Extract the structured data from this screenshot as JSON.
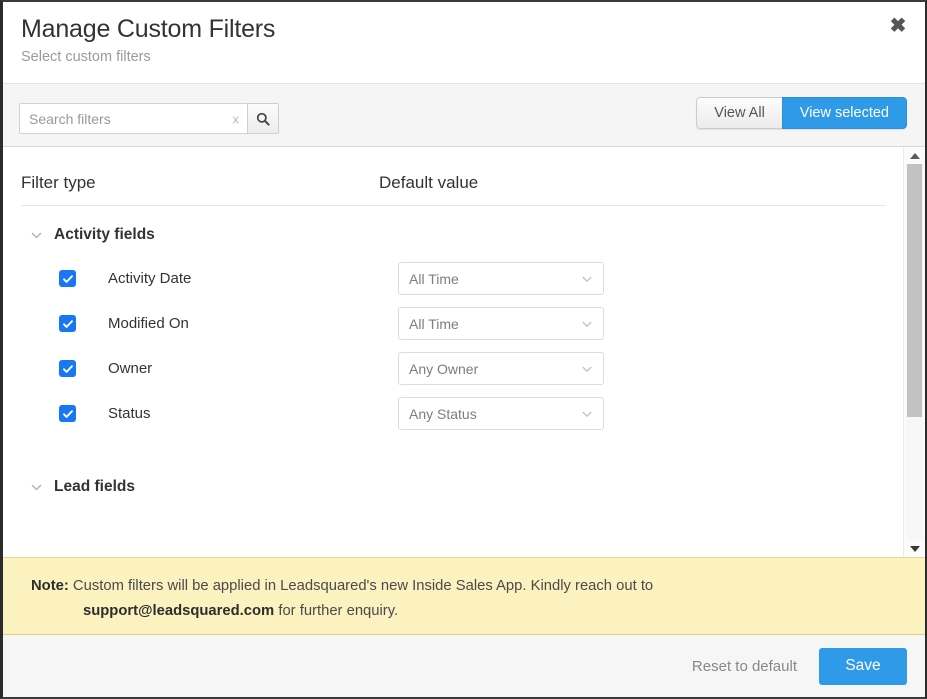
{
  "header": {
    "title": "Manage Custom Filters",
    "subtitle": "Select custom filters",
    "close_icon": "close-icon"
  },
  "toolbar": {
    "search_placeholder": "Search filters",
    "search_value": "",
    "clear_label": "x",
    "search_icon": "search-icon",
    "view_all_label": "View All",
    "view_selected_label": "View selected",
    "active_view": "View selected",
    "active_color": "#2f9ae8"
  },
  "table": {
    "col_filter_type": "Filter type",
    "col_default_value": "Default value"
  },
  "groups": [
    {
      "title": "Activity fields",
      "expanded": true,
      "rows": [
        {
          "label": "Activity Date",
          "checked": true,
          "default_value": "All Time"
        },
        {
          "label": "Modified On",
          "checked": true,
          "default_value": "All Time"
        },
        {
          "label": "Owner",
          "checked": true,
          "default_value": "Any Owner"
        },
        {
          "label": "Status",
          "checked": true,
          "default_value": "Any Status"
        }
      ]
    },
    {
      "title": "Lead fields",
      "expanded": true,
      "rows": []
    }
  ],
  "note": {
    "label": "Note:",
    "text_before": " Custom filters will be applied in Leadsquared's new Inside Sales App. Kindly reach out to",
    "email": "support@leadsquared.com",
    "text_after": " for further enquiry.",
    "background": "#fbf2c0"
  },
  "footer": {
    "reset_label": "Reset to default",
    "save_label": "Save",
    "save_color": "#2f9ae8"
  }
}
